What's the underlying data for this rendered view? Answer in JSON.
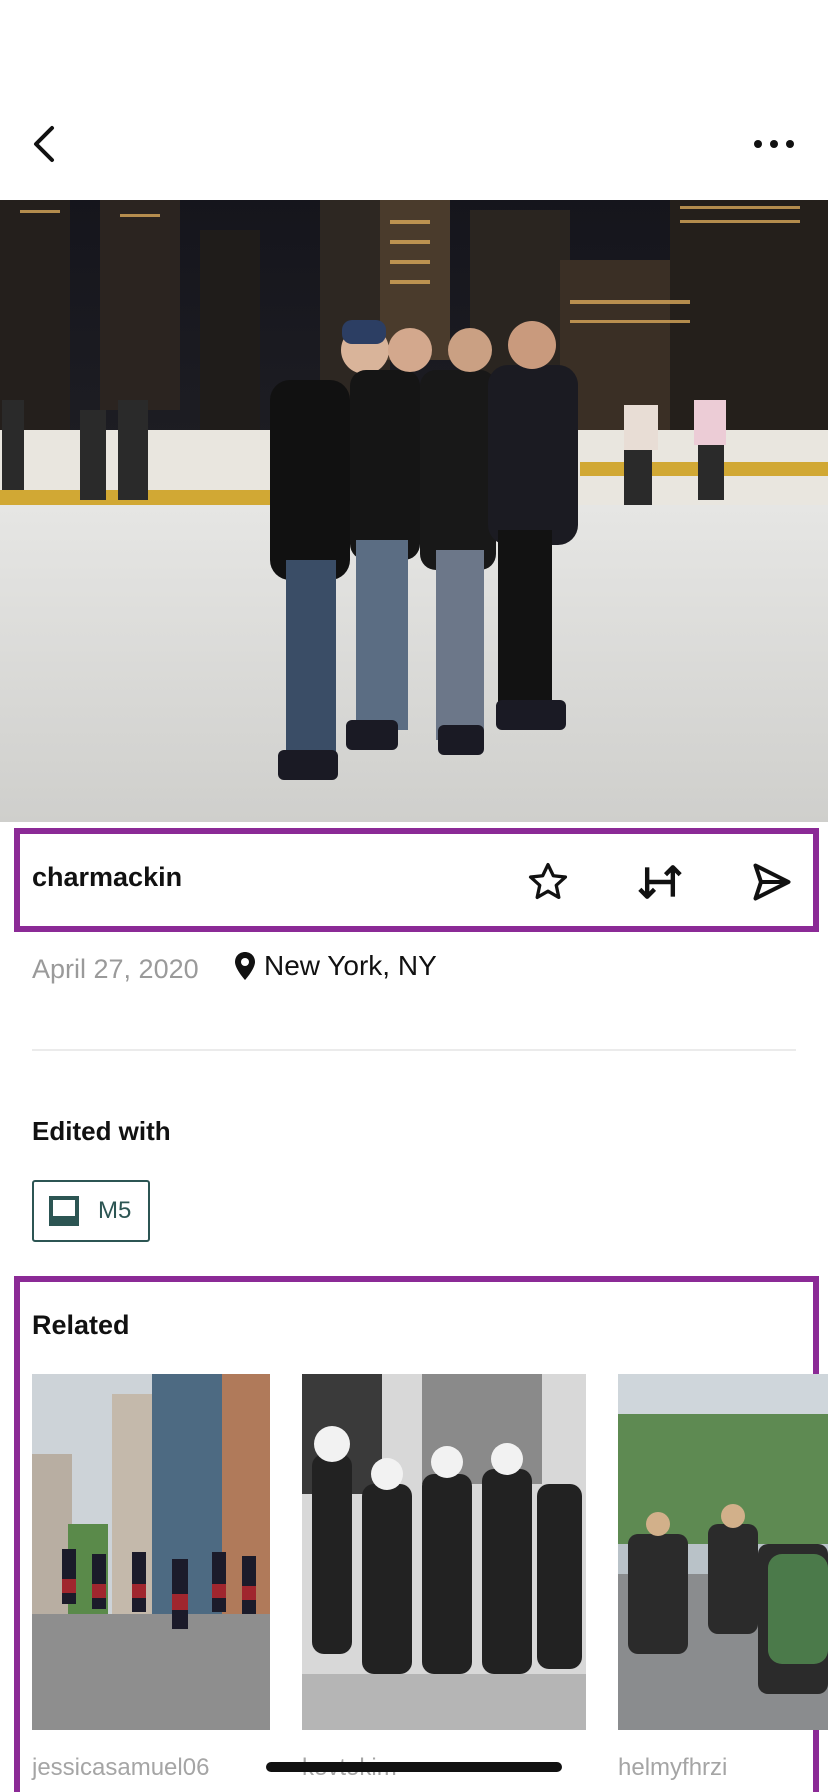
{
  "header": {
    "back_icon": "chevron-left-icon",
    "more_icon": "ellipsis-icon"
  },
  "photo": {
    "description_icon": "photo"
  },
  "actions": {
    "username": "charmackin",
    "favorite_icon": "star-icon",
    "remix_icon": "swap-arrows-icon",
    "share_icon": "send-icon"
  },
  "meta": {
    "date": "April 27, 2020",
    "location": "New York, NY",
    "location_icon": "location-pin-icon"
  },
  "edited": {
    "title": "Edited with",
    "preset_label": "M5",
    "preset_icon": "preset-icon"
  },
  "related": {
    "title": "Related",
    "items": [
      {
        "user": "jessicasamuel06"
      },
      {
        "user": "kevtokim"
      },
      {
        "user": "helmyfhrzi"
      }
    ]
  },
  "colors": {
    "highlight": "#8b2a96",
    "preset_accent": "#2c5553"
  }
}
